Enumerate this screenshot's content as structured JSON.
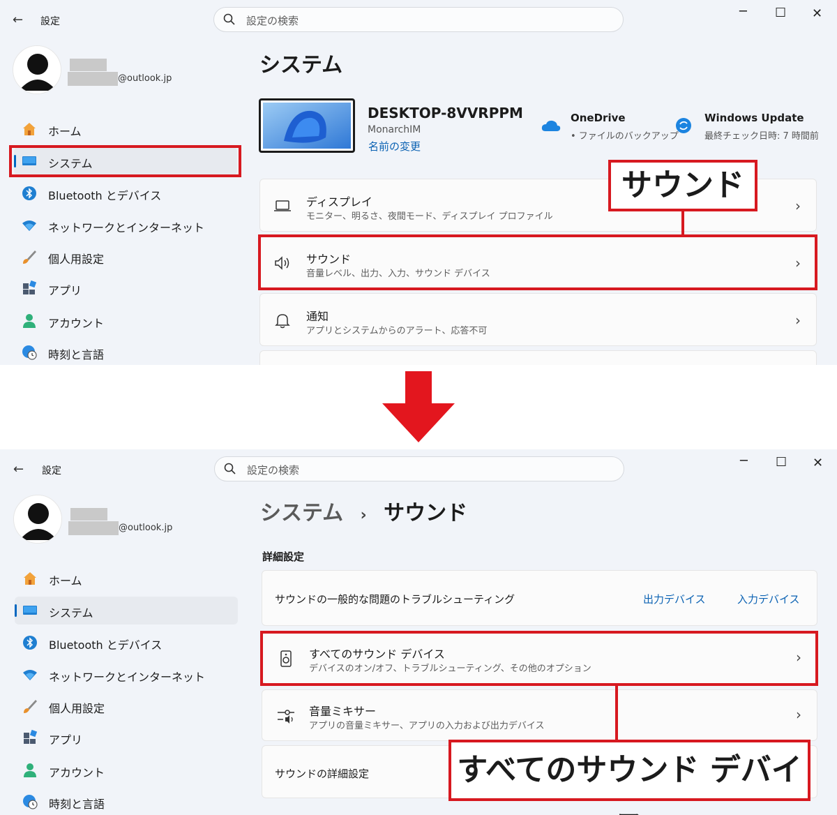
{
  "window": {
    "app_title": "設定",
    "search_placeholder": "設定の検索",
    "controls": {
      "minimize": "─",
      "maximize": "☐",
      "close": "✕"
    }
  },
  "account": {
    "email": "@outlook.jp"
  },
  "sidebar": {
    "items": [
      {
        "label": "ホーム",
        "icon": "home-icon"
      },
      {
        "label": "システム",
        "icon": "system-icon"
      },
      {
        "label": "Bluetooth とデバイス",
        "icon": "bluetooth-icon"
      },
      {
        "label": "ネットワークとインターネット",
        "icon": "wifi-icon"
      },
      {
        "label": "個人用設定",
        "icon": "brush-icon"
      },
      {
        "label": "アプリ",
        "icon": "apps-icon"
      },
      {
        "label": "アカウント",
        "icon": "account-icon"
      },
      {
        "label": "時刻と言語",
        "icon": "globe-clock-icon"
      }
    ]
  },
  "top": {
    "page_title": "システム",
    "device": {
      "name": "DESKTOP-8VVRPPM",
      "model": "MonarchIM",
      "rename_link": "名前の変更"
    },
    "onedrive": {
      "title": "OneDrive",
      "subtitle": "• ファイルのバックアップ"
    },
    "windows_update": {
      "title": "Windows Update",
      "subtitle": "最終チェック日時: 7 時間前"
    },
    "cards": [
      {
        "title": "ディスプレイ",
        "subtitle": "モニター、明るさ、夜間モード、ディスプレイ プロファイル"
      },
      {
        "title": "サウンド",
        "subtitle": "音量レベル、出力、入力、サウンド デバイス"
      },
      {
        "title": "通知",
        "subtitle": "アプリとシステムからのアラート、応答不可"
      }
    ],
    "callout": "サウンド"
  },
  "bottom": {
    "breadcrumb_parent": "システム",
    "breadcrumb_sep": "›",
    "breadcrumb_current": "サウンド",
    "section_header": "詳細設定",
    "troubleshoot": {
      "label": "サウンドの一般的な問題のトラブルシューティング",
      "link_output": "出力デバイス",
      "link_input": "入力デバイス"
    },
    "cards": [
      {
        "title": "すべてのサウンド デバイス",
        "subtitle": "デバイスのオン/オフ、トラブルシューティング、その他のオプション"
      },
      {
        "title": "音量ミキサー",
        "subtitle": "アプリの音量ミキサー、アプリの入力および出力デバイス"
      }
    ],
    "advanced": "サウンドの詳細設定",
    "callout": "すべてのサウンド デバイス"
  },
  "colors": {
    "accent": "#0067c0",
    "highlight_red": "#d71920",
    "arrow_red": "#e3161e"
  },
  "chevron": "›"
}
